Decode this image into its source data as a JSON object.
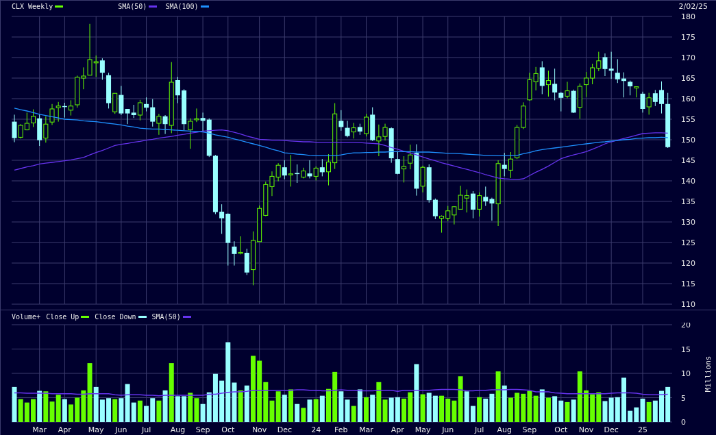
{
  "header": {
    "date": "2/02/25"
  },
  "price_chart": {
    "chart_data": {
      "type": "candlestick",
      "title": "CLX Weekly",
      "grid": true,
      "ylim": [
        110,
        180
      ],
      "categories": [
        null,
        null,
        null,
        null,
        null,
        null,
        null,
        null,
        null,
        null,
        null,
        null,
        null,
        null,
        null,
        null,
        null,
        null,
        null,
        null,
        null,
        null,
        null,
        null,
        null,
        null,
        null,
        null,
        null,
        null,
        null,
        null,
        null,
        null,
        null,
        null,
        null,
        null,
        null,
        null,
        null,
        null,
        null,
        null,
        null,
        null,
        null,
        null,
        null,
        null,
        null,
        null,
        null,
        null,
        null,
        null,
        null,
        null,
        null,
        null,
        null,
        null,
        null,
        null,
        null,
        null,
        null,
        null,
        null,
        null,
        null,
        null,
        null,
        null,
        null,
        null,
        null,
        null,
        null,
        null,
        null,
        null,
        null,
        null,
        null,
        null,
        null,
        null,
        null,
        null,
        null,
        null,
        null,
        null,
        null,
        null,
        null,
        null,
        null,
        null,
        null,
        null,
        null,
        null,
        null
      ],
      "yticks": [
        {
          "value": 110,
          "label": "110"
        },
        {
          "value": 115,
          "label": "115"
        },
        {
          "value": 120,
          "label": "120"
        },
        {
          "value": 125,
          "label": "125"
        },
        {
          "value": 130,
          "label": "130"
        },
        {
          "value": 135,
          "label": "135"
        },
        {
          "value": 140,
          "label": "140"
        },
        {
          "value": 145,
          "label": "145"
        },
        {
          "value": 150,
          "label": "150"
        },
        {
          "value": 155,
          "label": "155"
        },
        {
          "value": 160,
          "label": "160"
        },
        {
          "value": 165,
          "label": "165"
        },
        {
          "value": 170,
          "label": "170"
        },
        {
          "value": 175,
          "label": "175"
        },
        {
          "value": 180,
          "label": "180"
        }
      ],
      "ohlc": [
        [
          154.4,
          156.1,
          149.4,
          150.4
        ],
        [
          150.6,
          153.8,
          150.3,
          153.5
        ],
        [
          152.4,
          156.6,
          152.3,
          154.0
        ],
        [
          154.1,
          157.4,
          153.1,
          155.7
        ],
        [
          155.2,
          156.2,
          148.5,
          149.9
        ],
        [
          150.4,
          155.7,
          149.3,
          153.8
        ],
        [
          154.3,
          158.7,
          153.6,
          157.5
        ],
        [
          157.8,
          159.2,
          154.4,
          158.2
        ],
        [
          158.2,
          159.0,
          155.4,
          158.1
        ],
        [
          157.2,
          159.6,
          155.9,
          158.2
        ],
        [
          158.5,
          165.6,
          157.8,
          165.2
        ],
        [
          165.0,
          167.6,
          162.3,
          165.5
        ],
        [
          165.7,
          178.2,
          165.7,
          169.5
        ],
        [
          168.7,
          170.5,
          165.3,
          169.0
        ],
        [
          169.3,
          169.8,
          164.6,
          166.3
        ],
        [
          165.7,
          166.3,
          157.6,
          158.9
        ],
        [
          156.8,
          161.3,
          156.3,
          161.3
        ],
        [
          160.9,
          163.1,
          156.0,
          156.4
        ],
        [
          157.5,
          157.5,
          153.8,
          156.4
        ],
        [
          156.6,
          158.5,
          155.3,
          156.0
        ],
        [
          156.0,
          159.7,
          154.7,
          159.0
        ],
        [
          158.7,
          160.3,
          156.9,
          157.8
        ],
        [
          157.9,
          159.9,
          153.2,
          154.4
        ],
        [
          154.0,
          156.3,
          151.2,
          155.7
        ],
        [
          155.7,
          156.0,
          151.4,
          153.8
        ],
        [
          153.5,
          168.9,
          151.6,
          164.0
        ],
        [
          164.5,
          165.3,
          158.9,
          160.8
        ],
        [
          162.0,
          162.3,
          152.3,
          153.8
        ],
        [
          152.4,
          155.2,
          147.8,
          154.5
        ],
        [
          155.0,
          157.6,
          154.3,
          155.1
        ],
        [
          155.3,
          156.6,
          151.9,
          154.6
        ],
        [
          154.9,
          155.2,
          145.8,
          146.1
        ],
        [
          146.1,
          146.3,
          131.9,
          132.4
        ],
        [
          132.5,
          134.3,
          127.1,
          130.9
        ],
        [
          132.0,
          132.1,
          119.4,
          124.9
        ],
        [
          124.0,
          125.3,
          119.4,
          122.2
        ],
        [
          122.5,
          126.5,
          122.1,
          122.6
        ],
        [
          122.5,
          123.5,
          117.1,
          117.7
        ],
        [
          118.4,
          127.7,
          114.6,
          125.5
        ],
        [
          125.2,
          134.0,
          125.2,
          133.3
        ],
        [
          131.6,
          139.8,
          131.4,
          139.1
        ],
        [
          138.6,
          142.3,
          136.3,
          141.1
        ],
        [
          140.9,
          144.3,
          139.9,
          143.8
        ],
        [
          143.3,
          145.0,
          140.4,
          141.3
        ],
        [
          141.6,
          146.3,
          138.6,
          141.7
        ],
        [
          141.9,
          144.0,
          139.5,
          141.8
        ],
        [
          140.9,
          143.2,
          140.6,
          142.4
        ],
        [
          141.8,
          145.0,
          140.6,
          141.1
        ],
        [
          141.1,
          143.5,
          140.1,
          143.1
        ],
        [
          143.3,
          145.3,
          141.1,
          142.1
        ],
        [
          142.2,
          146.5,
          138.9,
          144.6
        ],
        [
          144.4,
          158.9,
          142.9,
          156.3
        ],
        [
          154.6,
          157.2,
          152.2,
          153.1
        ],
        [
          152.9,
          154.6,
          150.6,
          150.9
        ],
        [
          151.9,
          154.1,
          150.3,
          152.9
        ],
        [
          153.1,
          153.9,
          151.2,
          152.0
        ],
        [
          151.5,
          156.3,
          150.8,
          155.5
        ],
        [
          156.1,
          157.9,
          149.7,
          149.9
        ],
        [
          149.7,
          153.7,
          146.0,
          150.7
        ],
        [
          150.8,
          153.9,
          149.8,
          153.0
        ],
        [
          152.8,
          153.0,
          144.4,
          145.5
        ],
        [
          145.3,
          147.2,
          141.6,
          141.7
        ],
        [
          142.9,
          146.0,
          139.6,
          143.5
        ],
        [
          144.3,
          148.8,
          142.8,
          146.3
        ],
        [
          146.8,
          148.9,
          136.4,
          138.1
        ],
        [
          138.7,
          143.7,
          137.2,
          143.3
        ],
        [
          143.3,
          144.0,
          134.7,
          135.3
        ],
        [
          135.4,
          135.7,
          130.7,
          131.4
        ],
        [
          130.9,
          131.6,
          127.4,
          131.4
        ],
        [
          130.9,
          133.9,
          130.2,
          132.7
        ],
        [
          131.7,
          133.8,
          129.4,
          133.7
        ],
        [
          133.1,
          138.8,
          133.0,
          136.5
        ],
        [
          135.8,
          137.9,
          132.3,
          136.4
        ],
        [
          136.9,
          137.5,
          130.9,
          133.0
        ],
        [
          133.1,
          137.2,
          131.3,
          136.4
        ],
        [
          136.1,
          138.6,
          133.9,
          135.0
        ],
        [
          135.6,
          135.9,
          130.3,
          134.5
        ],
        [
          134.4,
          145.0,
          129.0,
          144.2
        ],
        [
          143.9,
          146.8,
          141.1,
          142.9
        ],
        [
          142.6,
          147.0,
          140.7,
          145.3
        ],
        [
          145.6,
          153.6,
          145.3,
          153.0
        ],
        [
          153.0,
          159.1,
          152.6,
          158.2
        ],
        [
          159.7,
          166.3,
          159.5,
          164.6
        ],
        [
          164.1,
          167.7,
          162.0,
          166.1
        ],
        [
          167.6,
          169.1,
          161.1,
          163.1
        ],
        [
          163.4,
          166.8,
          160.5,
          164.4
        ],
        [
          163.6,
          167.3,
          159.6,
          161.5
        ],
        [
          161.4,
          161.6,
          156.9,
          160.2
        ],
        [
          160.6,
          164.1,
          160.1,
          161.9
        ],
        [
          161.9,
          162.2,
          156.5,
          156.6
        ],
        [
          157.9,
          163.7,
          155.1,
          163.0
        ],
        [
          163.4,
          166.5,
          160.4,
          165.0
        ],
        [
          165.0,
          168.5,
          163.5,
          167.5
        ],
        [
          167.4,
          171.4,
          166.7,
          169.2
        ],
        [
          170.1,
          171.0,
          165.5,
          167.2
        ],
        [
          167.3,
          171.4,
          164.8,
          166.8
        ],
        [
          166.3,
          169.6,
          163.8,
          164.7
        ],
        [
          164.9,
          166.4,
          160.3,
          164.3
        ],
        [
          164.1,
          164.4,
          160.8,
          163.0
        ],
        [
          162.6,
          163.0,
          160.3,
          162.9
        ],
        [
          161.2,
          161.7,
          156.6,
          157.5
        ],
        [
          158.0,
          161.4,
          156.1,
          160.2
        ],
        [
          161.3,
          162.1,
          158.2,
          159.2
        ],
        [
          162.1,
          164.2,
          156.4,
          158.7
        ],
        [
          158.7,
          161.4,
          148.0,
          148.2
        ]
      ],
      "series": [
        {
          "name": "SMA(50)",
          "type": "line",
          "color": "#6633ee",
          "values": [
            142.6,
            143.0,
            143.4,
            143.7,
            144.1,
            144.3,
            144.5,
            144.7,
            144.9,
            145.1,
            145.4,
            145.7,
            146.3,
            146.9,
            147.4,
            148.0,
            148.6,
            148.9,
            149.1,
            149.4,
            149.6,
            149.9,
            150.1,
            150.4,
            150.6,
            150.8,
            151.1,
            151.3,
            151.6,
            151.8,
            152.1,
            152.2,
            152.3,
            152.4,
            152.2,
            151.8,
            151.4,
            150.9,
            150.5,
            150.1,
            150.0,
            149.9,
            149.9,
            149.8,
            149.7,
            149.6,
            149.5,
            149.5,
            149.4,
            149.4,
            149.4,
            149.4,
            149.4,
            149.4,
            149.4,
            149.3,
            149.2,
            149.1,
            149.0,
            148.6,
            148.1,
            147.7,
            147.2,
            146.8,
            146.3,
            145.8,
            145.3,
            144.9,
            144.4,
            144.0,
            143.6,
            143.2,
            142.8,
            142.4,
            142.0,
            141.5,
            141.1,
            140.7,
            140.5,
            140.4,
            140.3,
            140.5,
            141.3,
            142.1,
            142.8,
            143.6,
            144.5,
            145.4,
            145.9,
            146.3,
            146.7,
            147.1,
            147.7,
            148.3,
            149.0,
            149.5,
            149.9,
            150.3,
            150.7,
            151.1,
            151.5,
            151.6,
            151.7,
            151.7,
            151.6
          ]
        },
        {
          "name": "SMA(100)",
          "type": "line",
          "color": "#1e90ff",
          "values": [
            157.7,
            157.3,
            157.0,
            156.6,
            156.2,
            155.9,
            155.6,
            155.3,
            155.0,
            154.9,
            154.8,
            154.6,
            154.5,
            154.4,
            154.2,
            154.0,
            153.8,
            153.6,
            153.3,
            153.1,
            152.8,
            152.7,
            152.6,
            152.6,
            152.5,
            152.4,
            152.3,
            152.2,
            152.1,
            152.0,
            151.9,
            151.6,
            151.2,
            150.9,
            150.6,
            150.2,
            149.8,
            149.4,
            149.0,
            148.6,
            148.2,
            147.7,
            147.3,
            146.8,
            146.7,
            146.5,
            146.4,
            146.2,
            146.1,
            146.1,
            146.1,
            146.1,
            146.3,
            146.6,
            146.8,
            146.8,
            146.9,
            146.9,
            147.0,
            147.0,
            147.1,
            147.1,
            147.1,
            147.1,
            147.0,
            147.0,
            147.0,
            146.9,
            146.8,
            146.7,
            146.7,
            146.6,
            146.5,
            146.4,
            146.3,
            146.2,
            146.2,
            146.1,
            146.1,
            146.2,
            146.2,
            146.6,
            146.9,
            147.3,
            147.6,
            147.8,
            148.0,
            148.2,
            148.4,
            148.6,
            148.8,
            149.0,
            149.2,
            149.4,
            149.5,
            149.7,
            149.8,
            150.0,
            150.1,
            150.3,
            150.4,
            150.5,
            150.5,
            150.6,
            150.5
          ]
        }
      ]
    }
  },
  "volume_chart": {
    "chart_data": {
      "type": "bar",
      "title": "Volume+",
      "ylabel": "Millions",
      "grid": true,
      "categories": [
        null,
        null,
        null,
        null,
        "Mar",
        null,
        null,
        null,
        "Apr",
        null,
        null,
        null,
        null,
        "May",
        null,
        null,
        null,
        "Jun",
        null,
        null,
        null,
        "Jul",
        null,
        null,
        null,
        null,
        "Aug",
        null,
        null,
        null,
        "Sep",
        null,
        null,
        null,
        "Oct",
        null,
        null,
        null,
        null,
        "Nov",
        null,
        null,
        null,
        "Dec",
        null,
        null,
        null,
        null,
        "24",
        null,
        null,
        null,
        "Feb",
        null,
        null,
        null,
        "Mar",
        null,
        null,
        null,
        null,
        "Apr",
        null,
        null,
        null,
        "May",
        null,
        null,
        null,
        "Jun",
        null,
        null,
        null,
        null,
        "Jul",
        null,
        null,
        null,
        "Aug",
        null,
        null,
        null,
        "Sep",
        null,
        null,
        null,
        null,
        "Oct",
        null,
        null,
        null,
        "Nov",
        null,
        null,
        null,
        "Dec",
        null,
        null,
        null,
        null,
        "25",
        null,
        null,
        null,
        null
      ],
      "ylim": [
        0,
        20
      ],
      "yticks": [
        {
          "value": 0,
          "label": "0"
        },
        {
          "value": 5,
          "label": "5"
        },
        {
          "value": 10,
          "label": "10"
        },
        {
          "value": 15,
          "label": "15"
        },
        {
          "value": 20,
          "label": "20"
        }
      ],
      "series": [
        {
          "name": "Close Up",
          "color": "#66ff00",
          "values": [
            null,
            4.7,
            4.0,
            4.7,
            null,
            6.3,
            4.2,
            5.6,
            null,
            3.6,
            5.0,
            6.5,
            12.1,
            null,
            null,
            null,
            4.7,
            null,
            null,
            null,
            4.4,
            null,
            null,
            4.4,
            null,
            12.1,
            null,
            null,
            6.0,
            4.9,
            null,
            null,
            null,
            null,
            null,
            null,
            6.5,
            null,
            13.6,
            12.6,
            8.2,
            4.4,
            6.3,
            null,
            6.7,
            null,
            2.9,
            null,
            4.7,
            null,
            6.8,
            10.3,
            null,
            null,
            3.3,
            null,
            5.1,
            null,
            8.2,
            4.6,
            null,
            null,
            4.8,
            6.1,
            null,
            5.7,
            null,
            null,
            5.4,
            4.8,
            4.4,
            9.4,
            null,
            null,
            5.1,
            null,
            null,
            10.4,
            null,
            5.0,
            6.0,
            5.8,
            6.4,
            5.4,
            null,
            5.0,
            null,
            null,
            4.1,
            null,
            10.4,
            6.5,
            5.7,
            6.1,
            null,
            null,
            null,
            null,
            null,
            null,
            null,
            4.1,
            null,
            null,
            null
          ]
        },
        {
          "name": "Close Down",
          "color": "#99ffff",
          "values": [
            7.2,
            null,
            null,
            null,
            6.4,
            null,
            null,
            null,
            4.7,
            null,
            null,
            null,
            null,
            7.2,
            4.6,
            4.9,
            null,
            4.9,
            7.8,
            4.0,
            null,
            3.3,
            4.9,
            null,
            6.5,
            null,
            5.3,
            5.3,
            null,
            null,
            3.7,
            6.1,
            9.9,
            8.5,
            16.4,
            8.1,
            null,
            7.5,
            null,
            null,
            null,
            null,
            null,
            5.6,
            null,
            3.7,
            null,
            4.6,
            null,
            5.4,
            null,
            null,
            6.3,
            4.6,
            null,
            6.7,
            null,
            5.6,
            null,
            null,
            5.0,
            5.1,
            null,
            null,
            11.9,
            null,
            6.0,
            5.4,
            null,
            null,
            null,
            null,
            6.3,
            3.3,
            null,
            4.8,
            5.8,
            null,
            7.5,
            null,
            null,
            null,
            null,
            null,
            6.7,
            null,
            5.3,
            4.4,
            null,
            4.6,
            null,
            null,
            null,
            null,
            4.3,
            5.0,
            5.1,
            9.1,
            2.3,
            3.0,
            4.8,
            null,
            4.4,
            6.4,
            7.2
          ]
        },
        {
          "name": "SMA(50)",
          "type": "line",
          "color": "#6633ee",
          "values": [
            6.0,
            6.0,
            5.9,
            5.9,
            5.9,
            5.9,
            5.8,
            5.8,
            5.8,
            5.8,
            5.7,
            5.7,
            5.8,
            5.8,
            5.8,
            5.8,
            5.6,
            5.5,
            5.6,
            5.6,
            5.6,
            5.5,
            5.5,
            5.4,
            5.5,
            5.5,
            5.5,
            5.5,
            5.5,
            5.5,
            5.5,
            5.7,
            5.7,
            5.9,
            6.1,
            6.2,
            6.2,
            6.3,
            6.5,
            6.5,
            6.5,
            6.5,
            6.5,
            6.5,
            6.5,
            6.6,
            6.6,
            6.5,
            6.5,
            6.4,
            6.4,
            6.5,
            6.6,
            6.5,
            6.5,
            6.4,
            6.4,
            6.4,
            6.5,
            6.5,
            6.5,
            6.3,
            6.5,
            6.5,
            6.5,
            6.5,
            6.5,
            6.6,
            6.7,
            6.7,
            6.7,
            6.6,
            6.4,
            6.4,
            6.5,
            6.5,
            6.6,
            6.6,
            6.6,
            6.7,
            6.7,
            6.6,
            6.5,
            6.2,
            6.2,
            6.2,
            6.0,
            5.9,
            5.8,
            5.8,
            5.8,
            5.8,
            5.8,
            5.8,
            5.8,
            5.9,
            6.0,
            6.0,
            6.0,
            5.9,
            5.7,
            5.6,
            5.6,
            5.6,
            5.7
          ]
        }
      ]
    }
  }
}
